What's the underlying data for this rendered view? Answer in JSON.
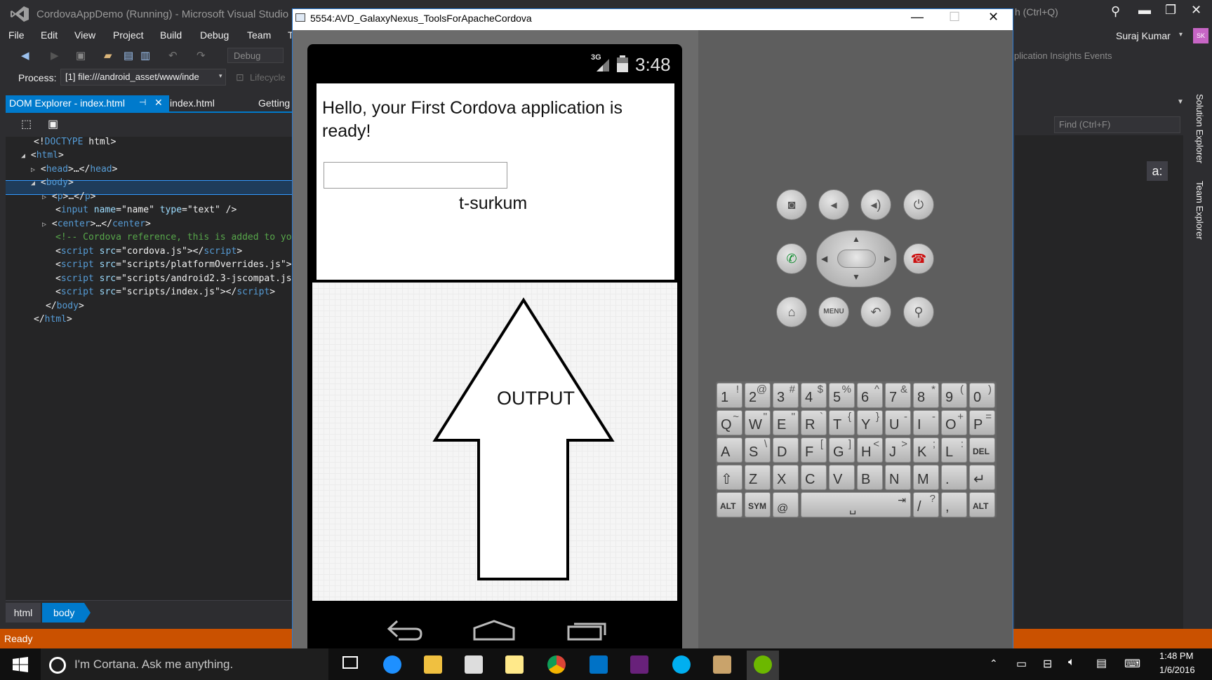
{
  "vs": {
    "title": "CordovaAppDemo (Running) - Microsoft Visual Studio",
    "quick_launch": "h (Ctrl+Q)",
    "menu": [
      "File",
      "Edit",
      "View",
      "Project",
      "Build",
      "Debug",
      "Team",
      "T"
    ],
    "user": "Suraj Kumar",
    "user_initials": "SK",
    "config": "Debug",
    "insights": "plication Insights Events",
    "process_label": "Process:",
    "process_value": "[1] file:///android_asset/www/inde",
    "lifecycle": "Lifecycle",
    "tabs": {
      "active": "DOM Explorer - index.html",
      "second": "index.html",
      "third": "Getting"
    },
    "find_placeholder": "Find (Ctrl+F)",
    "a_colon": "a:",
    "side_tabs": [
      "Solution Explorer",
      "Team Explorer"
    ],
    "status": "Ready",
    "breadcrumb": [
      "html",
      "body"
    ]
  },
  "dom_tree": {
    "doctype": "DOCTYPE",
    "doctype_rest": " html>",
    "html": "html",
    "head": "head",
    "body": "body",
    "p": "p",
    "input_tag": "input",
    "input_name_attr": "name",
    "input_name_val": "\"name\"",
    "input_type_attr": "type",
    "input_type_val": "\"text\"",
    "center": "center",
    "comment": "<!-- Cordova reference, this is added to yo",
    "script": "script",
    "src": "src",
    "script1": "\"cordova.js\"",
    "script2": "\"scripts/platformOverrides.js\"",
    "script3": "\"scripts/android2.3-jscompat.js",
    "script4": "\"scripts/index.js\""
  },
  "emulator": {
    "title": "5554:AVD_GalaxyNexus_ToolsForApacheCordova",
    "time": "3:48",
    "network": "3G",
    "app_heading": "Hello, your First Cordova application is ready!",
    "input_value": "",
    "center_text": "t-surkum",
    "annotation": "OUTPUT"
  },
  "keyboard": {
    "rows": [
      [
        [
          "1",
          "!"
        ],
        [
          "2",
          "@"
        ],
        [
          "3",
          "#"
        ],
        [
          "4",
          "$"
        ],
        [
          "5",
          "%"
        ],
        [
          "6",
          "^"
        ],
        [
          "7",
          "&"
        ],
        [
          "8",
          "*"
        ],
        [
          "9",
          "("
        ],
        [
          "0",
          ")"
        ]
      ],
      [
        [
          "Q",
          "~"
        ],
        [
          "W",
          "\""
        ],
        [
          "E",
          "\""
        ],
        [
          "R",
          "`"
        ],
        [
          "T",
          "{"
        ],
        [
          "Y",
          "}"
        ],
        [
          "U",
          "-"
        ],
        [
          "I",
          "-"
        ],
        [
          "O",
          "+"
        ],
        [
          "P",
          "="
        ]
      ],
      [
        [
          "A",
          ""
        ],
        [
          "S",
          "\\"
        ],
        [
          "D",
          ""
        ],
        [
          "F",
          "["
        ],
        [
          "G",
          "]"
        ],
        [
          "H",
          "<"
        ],
        [
          "J",
          ">"
        ],
        [
          "K",
          ";"
        ],
        [
          "L",
          ":"
        ],
        [
          "DEL",
          ""
        ]
      ],
      [
        [
          "⇧",
          ""
        ],
        [
          "Z",
          ""
        ],
        [
          "X",
          ""
        ],
        [
          "C",
          ""
        ],
        [
          "V",
          ""
        ],
        [
          "B",
          ""
        ],
        [
          "N",
          ""
        ],
        [
          "M",
          ""
        ],
        [
          ".",
          ""
        ],
        [
          "↵",
          ""
        ]
      ]
    ],
    "bottom": {
      "alt": "ALT",
      "sym": "SYM",
      "at": "@",
      "slash": "/",
      "question": "?",
      "comma": ",",
      "alt2": "ALT"
    }
  },
  "taskbar": {
    "cortana": "I'm Cortana. Ask me anything.",
    "time": "1:48 PM",
    "date": "1/6/2016"
  }
}
